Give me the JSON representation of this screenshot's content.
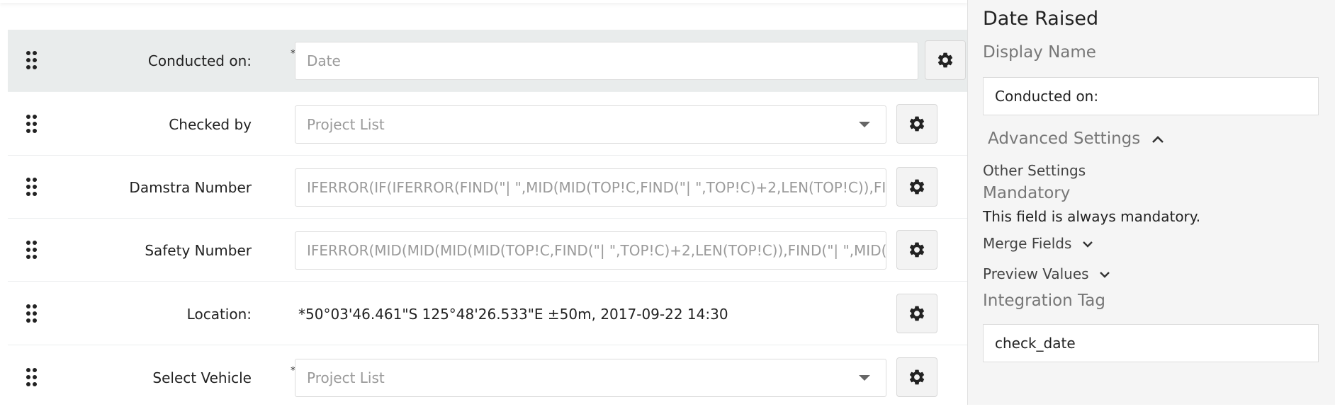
{
  "form": {
    "rows": [
      {
        "label": "Conducted on:",
        "placeholder": "Date",
        "mandatory_mark": "*",
        "settings_icon": "gear-icon"
      },
      {
        "label": "Checked by",
        "placeholder": "Project List",
        "settings_icon": "gear-icon",
        "dropdown_icon": "caret-down-icon"
      },
      {
        "label": "Damstra Number",
        "placeholder": "IFERROR(IF(IFERROR(FIND(\"| \",MID(MID(TOP!C,FIND(\"| \",TOP!C)+2,LEN(TOP!C)),FIND(\"",
        "settings_icon": "gear-icon"
      },
      {
        "label": "Safety Number",
        "placeholder": "IFERROR(MID(MID(MID(MID(TOP!C,FIND(\"| \",TOP!C)+2,LEN(TOP!C)),FIND(\"| \",MID(TOP",
        "settings_icon": "gear-icon"
      },
      {
        "label": "Location:",
        "value": "*50°03'46.461\"S 125°48'26.533\"E ±50m, 2017-09-22 14:30",
        "settings_icon": "gear-icon"
      },
      {
        "label": "Select Vehicle",
        "placeholder": "Project List",
        "mandatory_mark": "*",
        "settings_icon": "gear-icon",
        "dropdown_icon": "caret-down-icon"
      }
    ]
  },
  "panel": {
    "title": "Date Raised",
    "display_name_label": "Display Name",
    "display_name_value": "Conducted on:",
    "advanced_settings_label": "Advanced Settings",
    "other_settings_label": "Other Settings",
    "mandatory_label": "Mandatory",
    "mandatory_text": "This field is always mandatory.",
    "merge_fields_label": "Merge Fields",
    "preview_values_label": "Preview Values",
    "integration_tag_label": "Integration Tag",
    "integration_tag_value": "check_date"
  },
  "colors": {
    "selected_row": "#e9ecec",
    "panel_bg": "#f5f5f5",
    "placeholder": "#9a9a9a"
  }
}
